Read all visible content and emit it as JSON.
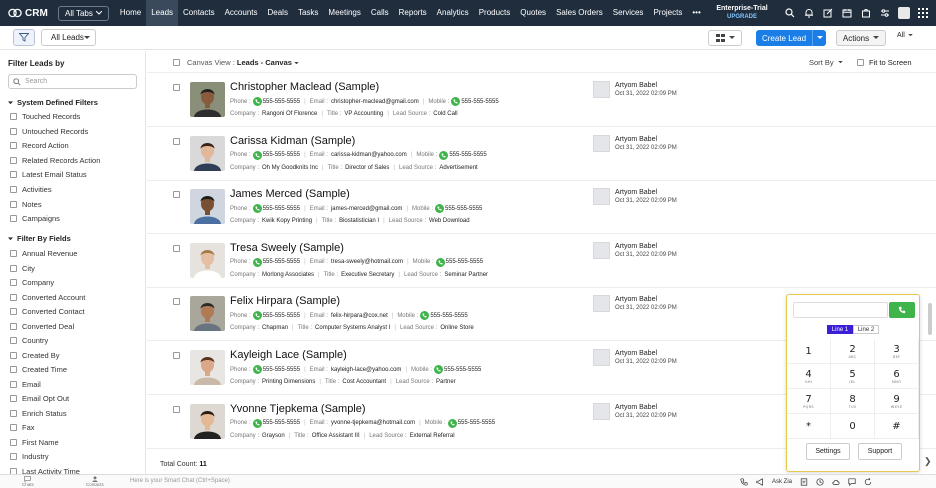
{
  "app": {
    "name": "CRM",
    "all_tabs_label": "All Tabs",
    "tabs": [
      "Home",
      "Leads",
      "Contacts",
      "Accounts",
      "Deals",
      "Tasks",
      "Meetings",
      "Calls",
      "Reports",
      "Analytics",
      "Products",
      "Quotes",
      "Sales Orders",
      "Services",
      "Projects",
      "•••"
    ],
    "active_tab": "Leads",
    "trial_label": "Enterprise-Trial",
    "upgrade_label": "UPGRADE"
  },
  "toolbar": {
    "view_label": "All Leads",
    "create_label": "Create Lead",
    "actions_label": "Actions",
    "all_label": "All"
  },
  "sidebar": {
    "title": "Filter Leads by",
    "search_placeholder": "Search",
    "system_title": "System Defined Filters",
    "system_filters": [
      "Touched Records",
      "Untouched Records",
      "Record Action",
      "Related Records Action",
      "Latest Email Status",
      "Activities",
      "Notes",
      "Campaigns"
    ],
    "fields_title": "Filter By Fields",
    "field_filters": [
      "Annual Revenue",
      "City",
      "Company",
      "Converted Account",
      "Converted Contact",
      "Converted Deal",
      "Country",
      "Created By",
      "Created Time",
      "Email",
      "Email Opt Out",
      "Enrich Status",
      "Fax",
      "First Name",
      "Industry",
      "Last Activity Time"
    ]
  },
  "main": {
    "canvas_view_label": "Canvas View :",
    "canvas_view_value": "Leads - Canvas",
    "sort_label": "Sort By",
    "fit_label": "Fit to Screen",
    "labels": {
      "phone": "Phone :",
      "email": "Email :",
      "mobile": "Mobile :",
      "company": "Company :",
      "title": "Title :",
      "lead_source": "Lead Source :"
    },
    "total_label": "Total Count:",
    "total_value": "11"
  },
  "records": [
    {
      "name": "Christopher Maclead (Sample)",
      "phone": "555-555-5555",
      "email": "christopher-maclead@gmail.com",
      "mobile": "555-555-5555",
      "company": "Rangoni Of Florence",
      "title": "VP Accounting",
      "lead_source": "Cold Call",
      "owner": "Artyom Babel",
      "date": "Oct 31, 2022 02:09 PM"
    },
    {
      "name": "Carissa Kidman (Sample)",
      "phone": "555-555-5555",
      "email": "carissa-kidman@yahoo.com",
      "mobile": "555-555-5555",
      "company": "Oh My Goodknits Inc",
      "title": "Director of Sales",
      "lead_source": "Advertisement",
      "owner": "Artyom Babel",
      "date": "Oct 31, 2022 02:09 PM"
    },
    {
      "name": "James Merced (Sample)",
      "phone": "555-555-5555",
      "email": "james-merced@gmail.com",
      "mobile": "555-555-5555",
      "company": "Kwik Kopy Printing",
      "title": "Biostatistician I",
      "lead_source": "Web Download",
      "owner": "Artyom Babel",
      "date": "Oct 31, 2022 02:09 PM"
    },
    {
      "name": "Tresa Sweely (Sample)",
      "phone": "555-555-5555",
      "email": "tresa-sweely@hotmail.com",
      "mobile": "555-555-5555",
      "company": "Morlong Associates",
      "title": "Executive Secretary",
      "lead_source": "Seminar Partner",
      "owner": "Artyom Babel",
      "date": "Oct 31, 2022 02:09 PM"
    },
    {
      "name": "Felix Hirpara (Sample)",
      "phone": "555-555-5555",
      "email": "felix-hirpara@cox.net",
      "mobile": "555-555-5555",
      "company": "Chapman",
      "title": "Computer Systems Analyst I",
      "lead_source": "Online Store",
      "owner": "Artyom Babel",
      "date": "Oct 31, 2022 02:09 PM"
    },
    {
      "name": "Kayleigh Lace (Sample)",
      "phone": "555-555-5555",
      "email": "kayleigh-lace@yahoo.com",
      "mobile": "555-555-5555",
      "company": "Printing Dimensions",
      "title": "Cost Accountant",
      "lead_source": "Partner",
      "owner": "Artyom Babel",
      "date": "Oct 31, 2022 02:09 PM"
    },
    {
      "name": "Yvonne Tjepkema (Sample)",
      "phone": "555-555-5555",
      "email": "yvonne-tjepkema@hotmail.com",
      "mobile": "555-555-5555",
      "company": "Grayson",
      "title": "Office Assistant III",
      "lead_source": "External Referral",
      "owner": "Artyom Babel",
      "date": "Oct 31, 2022 02:09 PM"
    }
  ],
  "dialer": {
    "lines": [
      "Line 1",
      "Line 2"
    ],
    "keys": [
      {
        "d": "1",
        "l": ""
      },
      {
        "d": "2",
        "l": "ABC"
      },
      {
        "d": "3",
        "l": "DEF"
      },
      {
        "d": "4",
        "l": "GHI"
      },
      {
        "d": "5",
        "l": "JKL"
      },
      {
        "d": "6",
        "l": "MNO"
      },
      {
        "d": "7",
        "l": "PQRS"
      },
      {
        "d": "8",
        "l": "TUV"
      },
      {
        "d": "9",
        "l": "WXYZ"
      },
      {
        "d": "*",
        "l": ""
      },
      {
        "d": "0",
        "l": ""
      },
      {
        "d": "#",
        "l": ""
      }
    ],
    "settings_label": "Settings",
    "support_label": "Support"
  },
  "bottombar": {
    "chats_label": "Chats",
    "contacts_label": "Contacts",
    "smartchat_placeholder": "Here is your Smart Chat (Ctrl+Space)",
    "ask_zia_label": "Ask Zia"
  },
  "colors": {
    "nav_bg": "#1f2d3d",
    "primary": "#1a7ee6",
    "call_green": "#3fb44a",
    "line_active": "#3a1fd6",
    "dialer_border": "#e7c84b"
  }
}
